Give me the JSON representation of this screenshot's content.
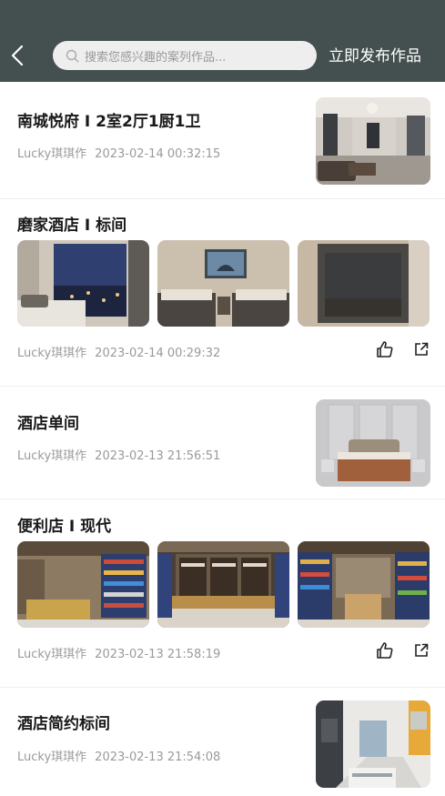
{
  "header": {
    "search_placeholder": "搜索您感兴趣的案列作品...",
    "publish_label": "立即发布作品"
  },
  "items": [
    {
      "title": "南城悦府 I 2室2厅1厨1卫",
      "author": "Lucky琪琪作",
      "date": "2023-02-14 00:32:15"
    },
    {
      "title": "磨家酒店 I 标间",
      "author": "Lucky琪琪作",
      "date": "2023-02-14 00:29:32"
    },
    {
      "title": "酒店单间",
      "author": "Lucky琪琪作",
      "date": "2023-02-13 21:56:51"
    },
    {
      "title": "便利店 I 现代",
      "author": "Lucky琪琪作",
      "date": "2023-02-13 21:58:19"
    },
    {
      "title": "酒店简约标间",
      "author": "Lucky琪琪作",
      "date": "2023-02-13 21:54:08"
    }
  ],
  "icons": {
    "back": "chevron-left-icon",
    "search": "search-icon",
    "like": "thumbs-up-icon",
    "share": "share-icon"
  },
  "colors": {
    "header_bg": "#44504f",
    "accent_text": "#ffffff",
    "meta_text": "#9a9a9a"
  }
}
